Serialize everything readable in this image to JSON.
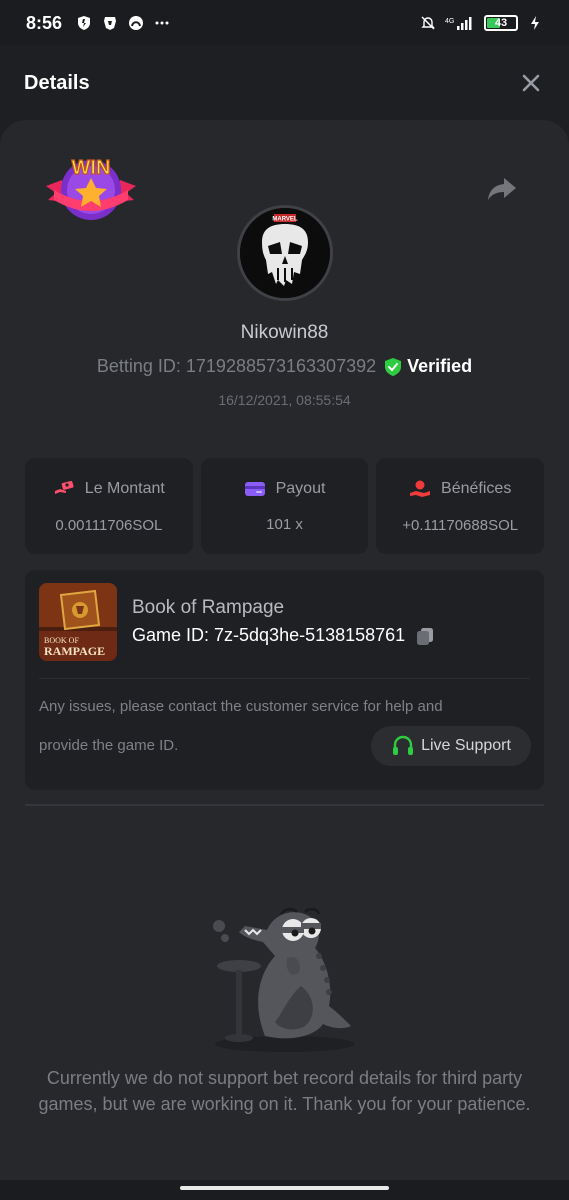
{
  "status_bar": {
    "time": "8:56",
    "battery": "43",
    "network": "4G"
  },
  "header": {
    "title": "Details"
  },
  "bet": {
    "username": "Nikowin88",
    "betting_id_label": "Betting ID: 1719288573163307392",
    "verified_label": "Verified",
    "timestamp": "16/12/2021, 08:55:54",
    "badge_text": "WIN",
    "avatar_text": "MARVEL"
  },
  "stats": [
    {
      "label": "Le Montant",
      "value": "0.00111706SOL",
      "icon": "money-hand-icon",
      "color": "#ff4f6d"
    },
    {
      "label": "Payout",
      "value": "101 x",
      "icon": "card-icon",
      "color": "#8b5cf6"
    },
    {
      "label": "Bénéfices",
      "value": "+0.11170688SOL",
      "icon": "profit-hand-icon",
      "color": "#ef3b3b"
    }
  ],
  "game": {
    "name": "Book of Rampage",
    "id_text": "Game ID: 7z-5dq3he-5138158761",
    "thumb_line1": "BOOK OF",
    "thumb_line2": "RAMPAGE",
    "issue_line1": "Any issues, please contact the customer service for help and",
    "issue_line2": "provide the game ID.",
    "support_label": "Live Support"
  },
  "empty_message": "Currently we do not support bet record details for third party games, but we are working on it. Thank you for your patience.",
  "colors": {
    "accent_green": "#2ecc40",
    "panel": "#27282c",
    "card": "#1f2023"
  }
}
